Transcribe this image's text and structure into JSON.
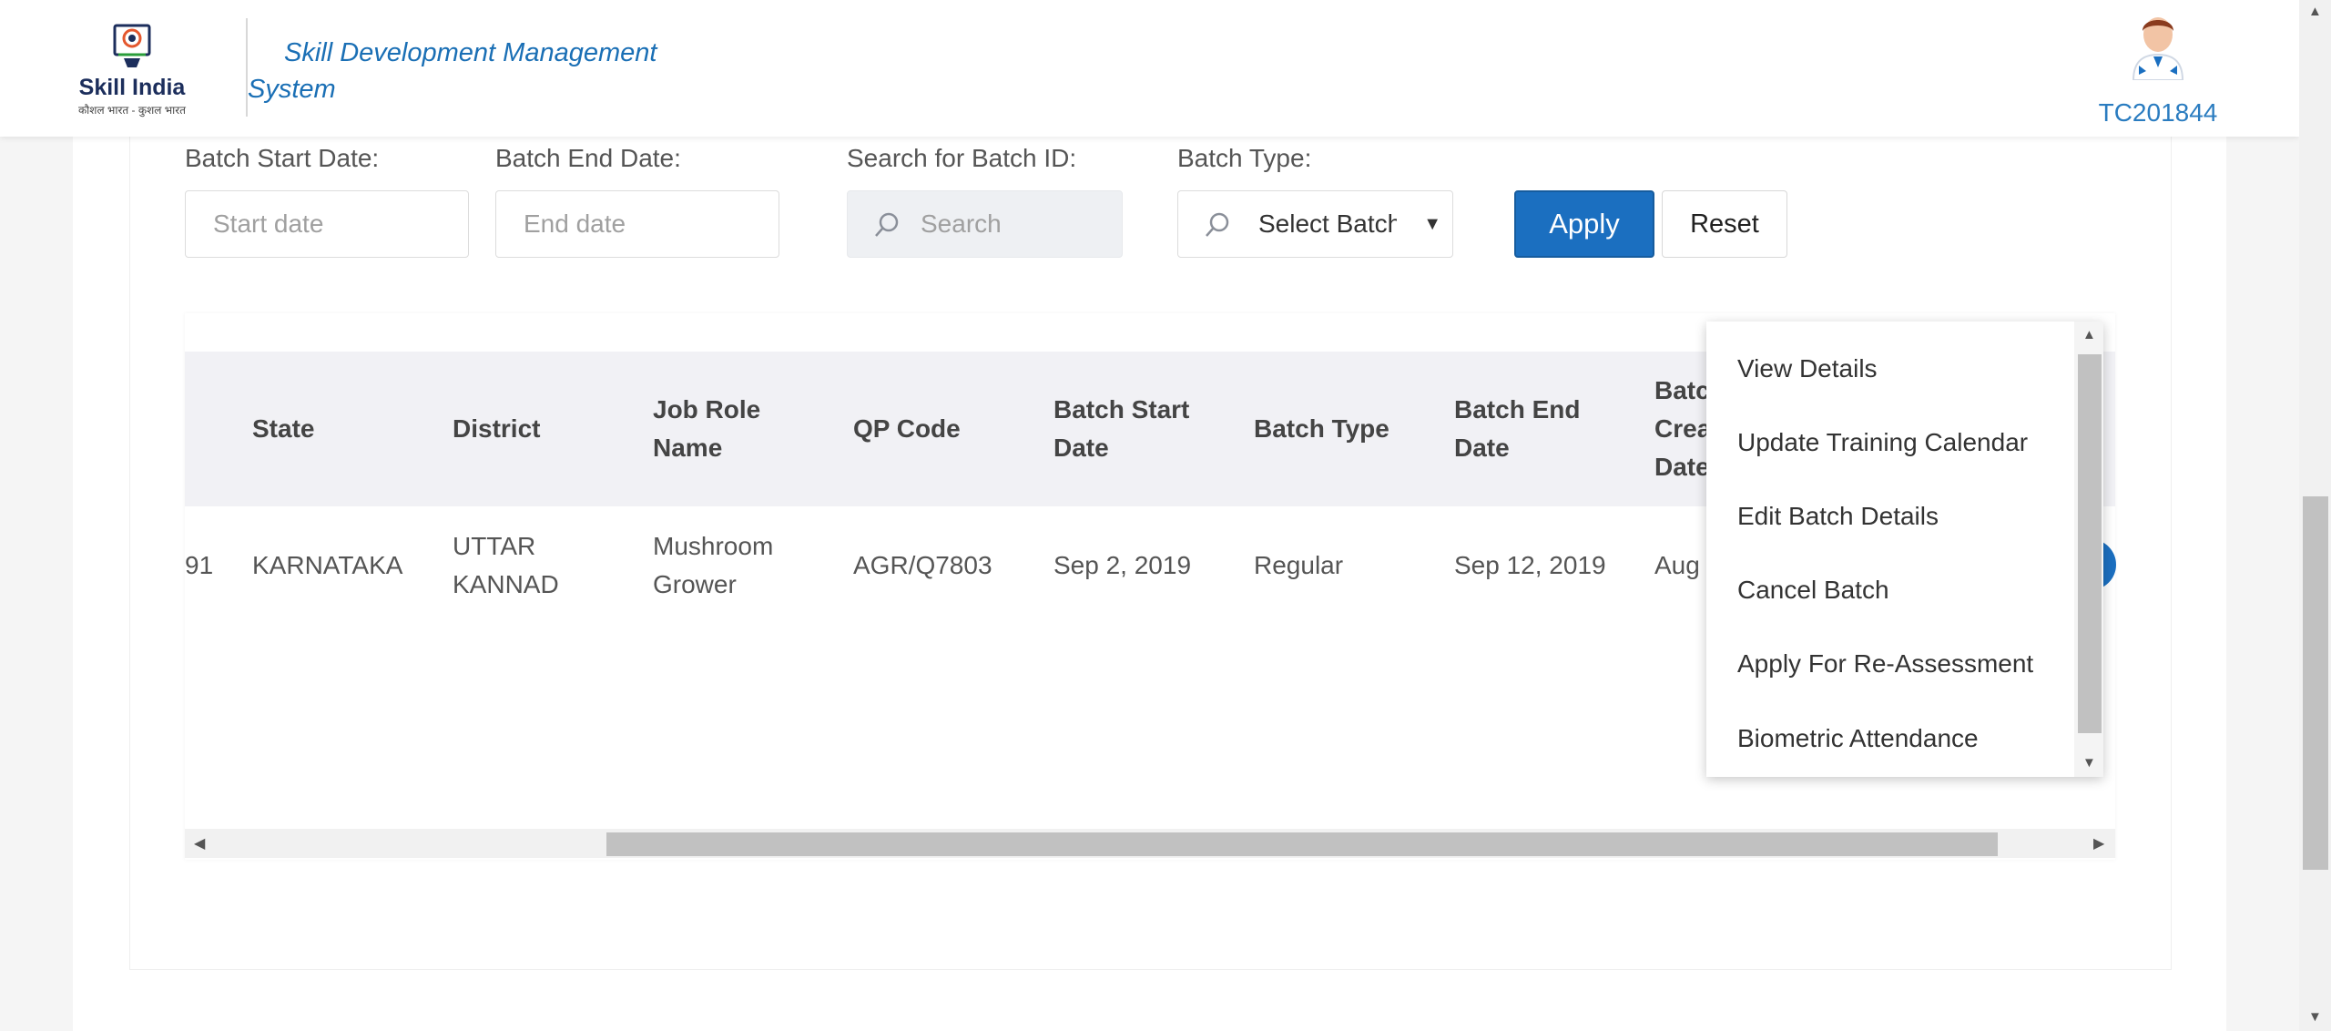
{
  "header": {
    "logo_text": "Skill India",
    "logo_subtext": "कौशल भारत - कुशल भारत",
    "app_title": "Skill Development Management System",
    "username": "TC201844"
  },
  "filters": {
    "start_label": "Batch Start Date:",
    "start_placeholder": "Start date",
    "end_label": "Batch End Date:",
    "end_placeholder": "End date",
    "search_label": "Search for Batch ID:",
    "search_placeholder": "Search",
    "type_label": "Batch Type:",
    "type_value": "Select Batch",
    "apply_label": "Apply",
    "reset_label": "Reset"
  },
  "table": {
    "headers": [
      "State",
      "District",
      "Job Role Name",
      "QP Code",
      "Batch Start Date",
      "Batch Type",
      "Batch End Date",
      "Batch Created Date"
    ],
    "rows": [
      {
        "id_fragment": "91",
        "cells": [
          "KARNATAKA",
          "UTTAR KANNAD",
          "Mushroom Grower",
          "AGR/Q7803",
          "Sep 2, 2019",
          "Regular",
          "Sep 12, 2019",
          "Aug"
        ]
      }
    ]
  },
  "menu": {
    "items": [
      "View Details",
      "Update Training Calendar",
      "Edit Batch Details",
      "Cancel Batch",
      "Apply For Re-Assessment",
      "Biometric Attendance"
    ]
  },
  "colors": {
    "accent": "#1b6fc0",
    "title_blue": "#1a6fb5"
  }
}
